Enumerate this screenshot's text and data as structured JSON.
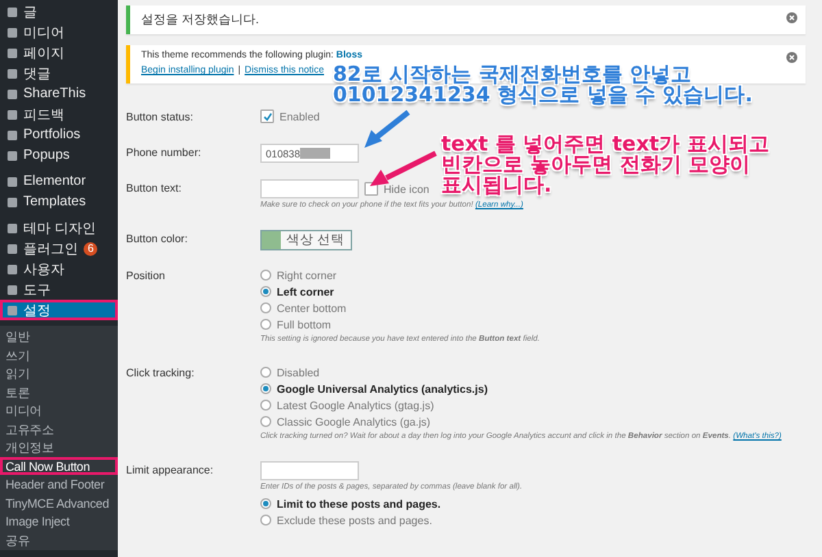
{
  "sidebar": {
    "menu_groups": [
      [
        {
          "label": "글",
          "selected": false,
          "highlighted": false
        },
        {
          "label": "미디어",
          "selected": false,
          "highlighted": false
        },
        {
          "label": "페이지",
          "selected": false,
          "highlighted": false
        },
        {
          "label": "댓글",
          "selected": false,
          "highlighted": false
        },
        {
          "label": "ShareThis",
          "selected": false,
          "highlighted": false
        },
        {
          "label": "피드백",
          "selected": false,
          "highlighted": false
        },
        {
          "label": "Portfolios",
          "selected": false,
          "highlighted": false
        },
        {
          "label": "Popups",
          "selected": false,
          "highlighted": false
        }
      ],
      [
        {
          "label": "Elementor",
          "selected": false,
          "highlighted": false
        },
        {
          "label": "Templates",
          "selected": false,
          "highlighted": false
        }
      ],
      [
        {
          "label": "테마 디자인",
          "selected": false,
          "highlighted": false
        },
        {
          "label": "플러그인",
          "selected": false,
          "highlighted": false,
          "count": "6"
        },
        {
          "label": "사용자",
          "selected": false,
          "highlighted": false
        },
        {
          "label": "도구",
          "selected": false,
          "highlighted": false
        },
        {
          "label": "설정",
          "selected": true,
          "highlighted": true
        }
      ]
    ],
    "submenu": [
      {
        "label": "일반",
        "selected": false,
        "highlighted": false
      },
      {
        "label": "쓰기",
        "selected": false,
        "highlighted": false
      },
      {
        "label": "읽기",
        "selected": false,
        "highlighted": false
      },
      {
        "label": "토론",
        "selected": false,
        "highlighted": false
      },
      {
        "label": "미디어",
        "selected": false,
        "highlighted": false
      },
      {
        "label": "고유주소",
        "selected": false,
        "highlighted": false
      },
      {
        "label": "개인정보",
        "selected": false,
        "highlighted": false
      },
      {
        "label": "Call Now Button",
        "selected": true,
        "highlighted": true
      },
      {
        "label": "Header and Footer",
        "selected": false,
        "highlighted": false
      },
      {
        "label": "TinyMCE Advanced",
        "selected": false,
        "highlighted": false
      },
      {
        "label": "Image Inject",
        "selected": false,
        "highlighted": false
      },
      {
        "label": "공유",
        "selected": false,
        "highlighted": false
      }
    ]
  },
  "notices": [
    {
      "kind": "success",
      "text": "설정을 저장했습니다."
    },
    {
      "kind": "warning",
      "text": "This theme recommends the following plugin:",
      "plugin_link": "Bloss",
      "links": [
        "Begin installing plugin",
        "Dismiss this notice"
      ],
      "separator": "|"
    }
  ],
  "form": [
    {
      "kind": "checkbox",
      "label": "Button status:",
      "option": {
        "label": "Enabled",
        "checked": true
      }
    },
    {
      "kind": "field",
      "label": "Phone number:",
      "value": "010838",
      "redacted": true
    },
    {
      "kind": "field",
      "label": "Button text:",
      "checkbox": {
        "label": "Hide icon",
        "checked": false
      },
      "note": "Make sure to check on your phone if the text fits your button!",
      "note_link": "(Learn why...)"
    },
    {
      "kind": "color",
      "label": "Button color:",
      "color": "#8fbc8f",
      "button": "색상 선택"
    },
    {
      "kind": "radios",
      "label": "Position",
      "options": [
        {
          "label": "Right corner",
          "selected": false
        },
        {
          "label": "Left corner",
          "selected": true
        },
        {
          "label": "Center bottom",
          "selected": false
        },
        {
          "label": "Full bottom",
          "selected": false
        }
      ],
      "note": "This setting is ignored because you have text entered into the **Button text** field."
    },
    {
      "kind": "radios",
      "label": "Click tracking:",
      "options": [
        {
          "label": "Disabled",
          "selected": false
        },
        {
          "label": "Google Universal Analytics (analytics.js)",
          "selected": true
        },
        {
          "label": "Latest Google Analytics (gtag.js)",
          "selected": false
        },
        {
          "label": "Classic Google Analytics (ga.js)",
          "selected": false
        }
      ],
      "note": "Click tracking turned on? Wait for about a day then log into your Google Analytics accunt and click in the **Behavior** section on **Events**.",
      "note_link": "(What's this?)"
    },
    {
      "kind": "field-radios",
      "label": "Limit appearance:",
      "note": "Enter IDs of the posts & pages, separated by commas (leave blank for all).",
      "options": [
        {
          "label": "Limit to these posts and pages.",
          "selected": true
        },
        {
          "label": "Exclude these posts and pages.",
          "selected": false
        }
      ]
    }
  ],
  "annotations": [
    {
      "color": "#2f7fd8",
      "lines": [
        "82로 시작하는 국제전화번호를 안넣고",
        "01012341234 형식으로 넣을 수 있습니다."
      ]
    },
    {
      "color": "#e8196a",
      "lines": [
        "text 를 넣어주면 text가 표시되고",
        "빈칸으로 놓아두면 전화기 모양이",
        "표시됩니다."
      ]
    }
  ]
}
